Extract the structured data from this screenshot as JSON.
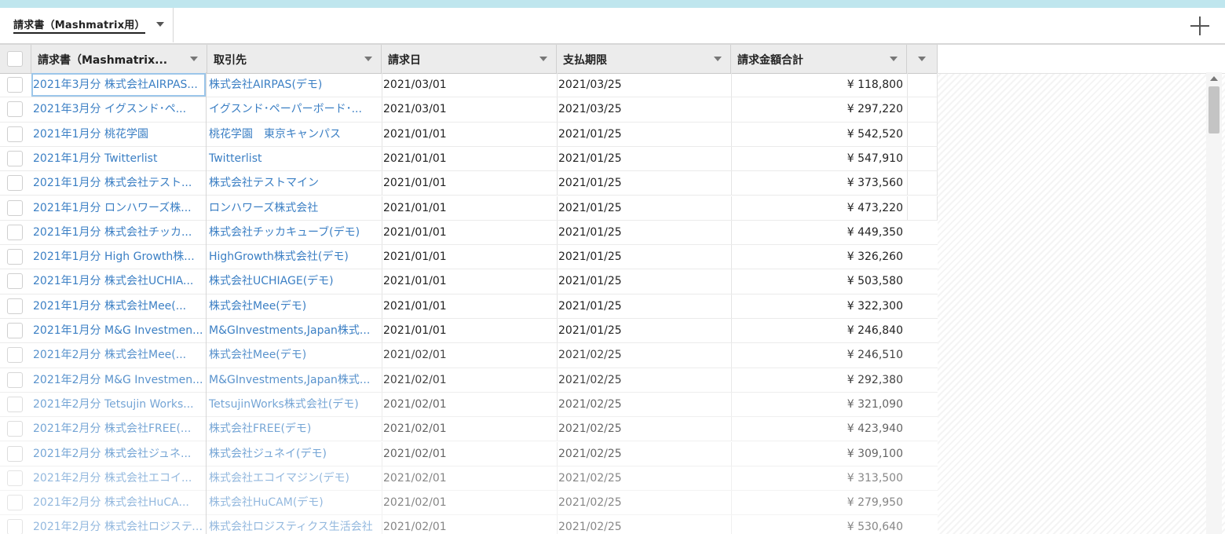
{
  "tab": {
    "label": "請求書（Mashmatrix用）"
  },
  "columns": [
    {
      "label": "請求書（Mashmatrix..."
    },
    {
      "label": "取引先"
    },
    {
      "label": "請求日"
    },
    {
      "label": "支払期限"
    },
    {
      "label": "請求金額合計"
    }
  ],
  "rows": [
    {
      "name": "2021年3月分 株式会社AIRPAS...",
      "client": "株式会社AIRPAS(デモ)",
      "date": "2021/03/01",
      "due": "2021/03/25",
      "amount": "¥ 118,800"
    },
    {
      "name": "2021年3月分 イグスンド･ペ...",
      "client": "イグスンド･ペーパーボード･...",
      "date": "2021/03/01",
      "due": "2021/03/25",
      "amount": "¥ 297,220"
    },
    {
      "name": "2021年1月分 桃花学園",
      "client": "桃花学園　東京キャンパス",
      "date": "2021/01/01",
      "due": "2021/01/25",
      "amount": "¥ 542,520"
    },
    {
      "name": "2021年1月分 Twitterlist",
      "client": "Twitterlist",
      "date": "2021/01/01",
      "due": "2021/01/25",
      "amount": "¥ 547,910"
    },
    {
      "name": "2021年1月分 株式会社テスト...",
      "client": "株式会社テストマイン",
      "date": "2021/01/01",
      "due": "2021/01/25",
      "amount": "¥ 373,560"
    },
    {
      "name": "2021年1月分 ロンハワーズ株...",
      "client": "ロンハワーズ株式会社",
      "date": "2021/01/01",
      "due": "2021/01/25",
      "amount": "¥ 473,220"
    },
    {
      "name": "2021年1月分 株式会社チッカ...",
      "client": "株式会社チッカキューブ(デモ)",
      "date": "2021/01/01",
      "due": "2021/01/25",
      "amount": "¥ 449,350"
    },
    {
      "name": "2021年1月分 High Growth株...",
      "client": "HighGrowth株式会社(デモ)",
      "date": "2021/01/01",
      "due": "2021/01/25",
      "amount": "¥ 326,260"
    },
    {
      "name": "2021年1月分 株式会社UCHIA...",
      "client": "株式会社UCHIAGE(デモ)",
      "date": "2021/01/01",
      "due": "2021/01/25",
      "amount": "¥ 503,580"
    },
    {
      "name": "2021年1月分 株式会社Mee(...",
      "client": "株式会社Mee(デモ)",
      "date": "2021/01/01",
      "due": "2021/01/25",
      "amount": "¥ 322,300"
    },
    {
      "name": "2021年1月分 M&G Investmen...",
      "client": "M&GInvestments,Japan株式...",
      "date": "2021/01/01",
      "due": "2021/01/25",
      "amount": "¥ 246,840"
    },
    {
      "name": "2021年2月分 株式会社Mee(...",
      "client": "株式会社Mee(デモ)",
      "date": "2021/02/01",
      "due": "2021/02/25",
      "amount": "¥ 246,510"
    },
    {
      "name": "2021年2月分 M&G Investmen...",
      "client": "M&GInvestments,Japan株式...",
      "date": "2021/02/01",
      "due": "2021/02/25",
      "amount": "¥ 292,380"
    },
    {
      "name": "2021年2月分 Tetsujin Works...",
      "client": "TetsujinWorks株式会社(デモ)",
      "date": "2021/02/01",
      "due": "2021/02/25",
      "amount": "¥ 321,090"
    },
    {
      "name": "2021年2月分 株式会社FREE(...",
      "client": "株式会社FREE(デモ)",
      "date": "2021/02/01",
      "due": "2021/02/25",
      "amount": "¥ 423,940"
    },
    {
      "name": "2021年2月分 株式会社ジュネ...",
      "client": "株式会社ジュネイ(デモ)",
      "date": "2021/02/01",
      "due": "2021/02/25",
      "amount": "¥ 309,100"
    },
    {
      "name": "2021年2月分 株式会社エコイ...",
      "client": "株式会社エコイマジン(デモ)",
      "date": "2021/02/01",
      "due": "2021/02/25",
      "amount": "¥ 313,500"
    },
    {
      "name": "2021年2月分 株式会社HuCA...",
      "client": "株式会社HuCAM(デモ)",
      "date": "2021/02/01",
      "due": "2021/02/25",
      "amount": "¥ 279,950"
    },
    {
      "name": "2021年2月分 株式会社ロジスティ...",
      "client": "株式会社ロジスティクス生活会社",
      "date": "2021/02/01",
      "due": "2021/02/25",
      "amount": "¥ 530,640"
    }
  ]
}
